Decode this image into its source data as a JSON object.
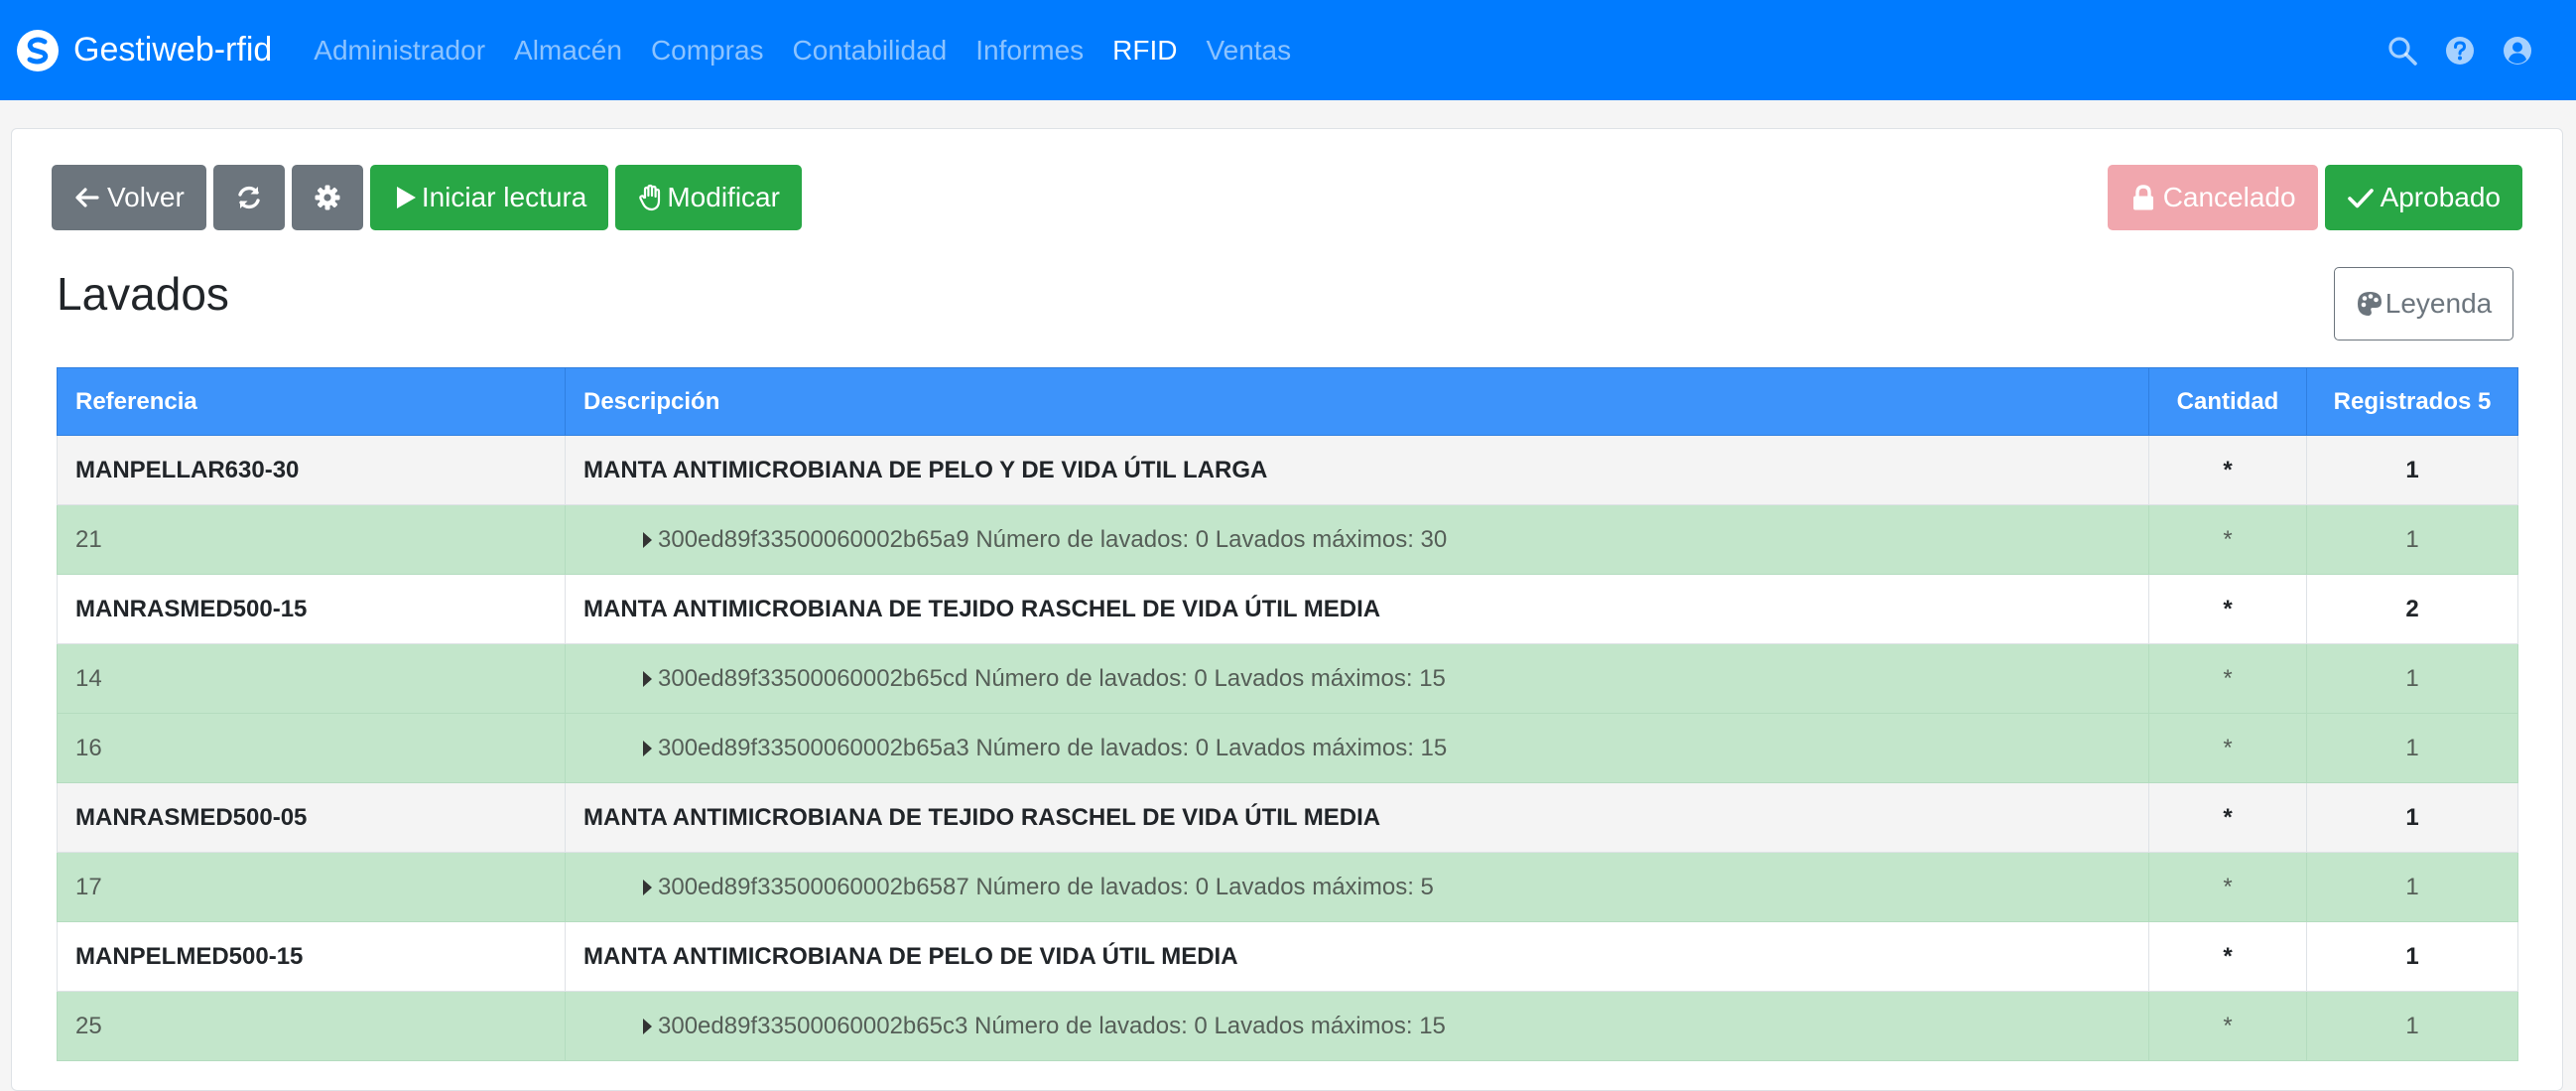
{
  "navbar": {
    "brand": "Gestiweb-rfid",
    "links": [
      {
        "label": "Administrador",
        "active": false
      },
      {
        "label": "Almacén",
        "active": false
      },
      {
        "label": "Compras",
        "active": false
      },
      {
        "label": "Contabilidad",
        "active": false
      },
      {
        "label": "Informes",
        "active": false
      },
      {
        "label": "RFID",
        "active": true
      },
      {
        "label": "Ventas",
        "active": false
      }
    ],
    "icons": [
      "search-icon",
      "help-icon",
      "user-icon"
    ]
  },
  "toolbar": {
    "back_label": "Volver",
    "refresh_icon": "refresh-icon",
    "settings_icon": "gear-icon",
    "start_read_label": "Iniciar lectura",
    "modify_label": "Modificar",
    "cancelled_label": "Cancelado",
    "approved_label": "Aprobado"
  },
  "page": {
    "title": "Lavados",
    "legend_label": "Leyenda"
  },
  "table": {
    "headers": {
      "referencia": "Referencia",
      "descripcion": "Descripción",
      "cantidad": "Cantidad",
      "registrados": "Registrados 5"
    },
    "rows": [
      {
        "type": "parent",
        "ref": "MANPELLAR630-30",
        "desc": "MANTA ANTIMICROBIANA DE PELO Y DE VIDA ÚTIL LARGA",
        "qty": "*",
        "reg": "1"
      },
      {
        "type": "child",
        "ref": "21",
        "desc": "300ed89f33500060002b65a9 Número de lavados: 0 Lavados máximos: 30",
        "qty": "*",
        "reg": "1"
      },
      {
        "type": "parent",
        "ref": "MANRASMED500-15",
        "desc": "MANTA ANTIMICROBIANA DE TEJIDO RASCHEL DE VIDA ÚTIL MEDIA",
        "qty": "*",
        "reg": "2"
      },
      {
        "type": "child",
        "ref": "14",
        "desc": "300ed89f33500060002b65cd Número de lavados: 0 Lavados máximos: 15",
        "qty": "*",
        "reg": "1"
      },
      {
        "type": "child",
        "ref": "16",
        "desc": "300ed89f33500060002b65a3 Número de lavados: 0 Lavados máximos: 15",
        "qty": "*",
        "reg": "1"
      },
      {
        "type": "parent",
        "ref": "MANRASMED500-05",
        "desc": "MANTA ANTIMICROBIANA DE TEJIDO RASCHEL DE VIDA ÚTIL MEDIA",
        "qty": "*",
        "reg": "1"
      },
      {
        "type": "child",
        "ref": "17",
        "desc": "300ed89f33500060002b6587 Número de lavados: 0 Lavados máximos: 5",
        "qty": "*",
        "reg": "1"
      },
      {
        "type": "parent",
        "ref": "MANPELMED500-15",
        "desc": "MANTA ANTIMICROBIANA DE PELO DE VIDA ÚTIL MEDIA",
        "qty": "*",
        "reg": "1"
      },
      {
        "type": "child",
        "ref": "25",
        "desc": "300ed89f33500060002b65c3 Número de lavados: 0 Lavados máximos: 15",
        "qty": "*",
        "reg": "1"
      }
    ]
  },
  "colors": {
    "navbar": "#007bff",
    "table_header": "#3d93fa",
    "child_row": "#c3e6cb",
    "success": "#28a745",
    "secondary": "#6c757d",
    "danger_disabled": "#f1a7ae"
  }
}
